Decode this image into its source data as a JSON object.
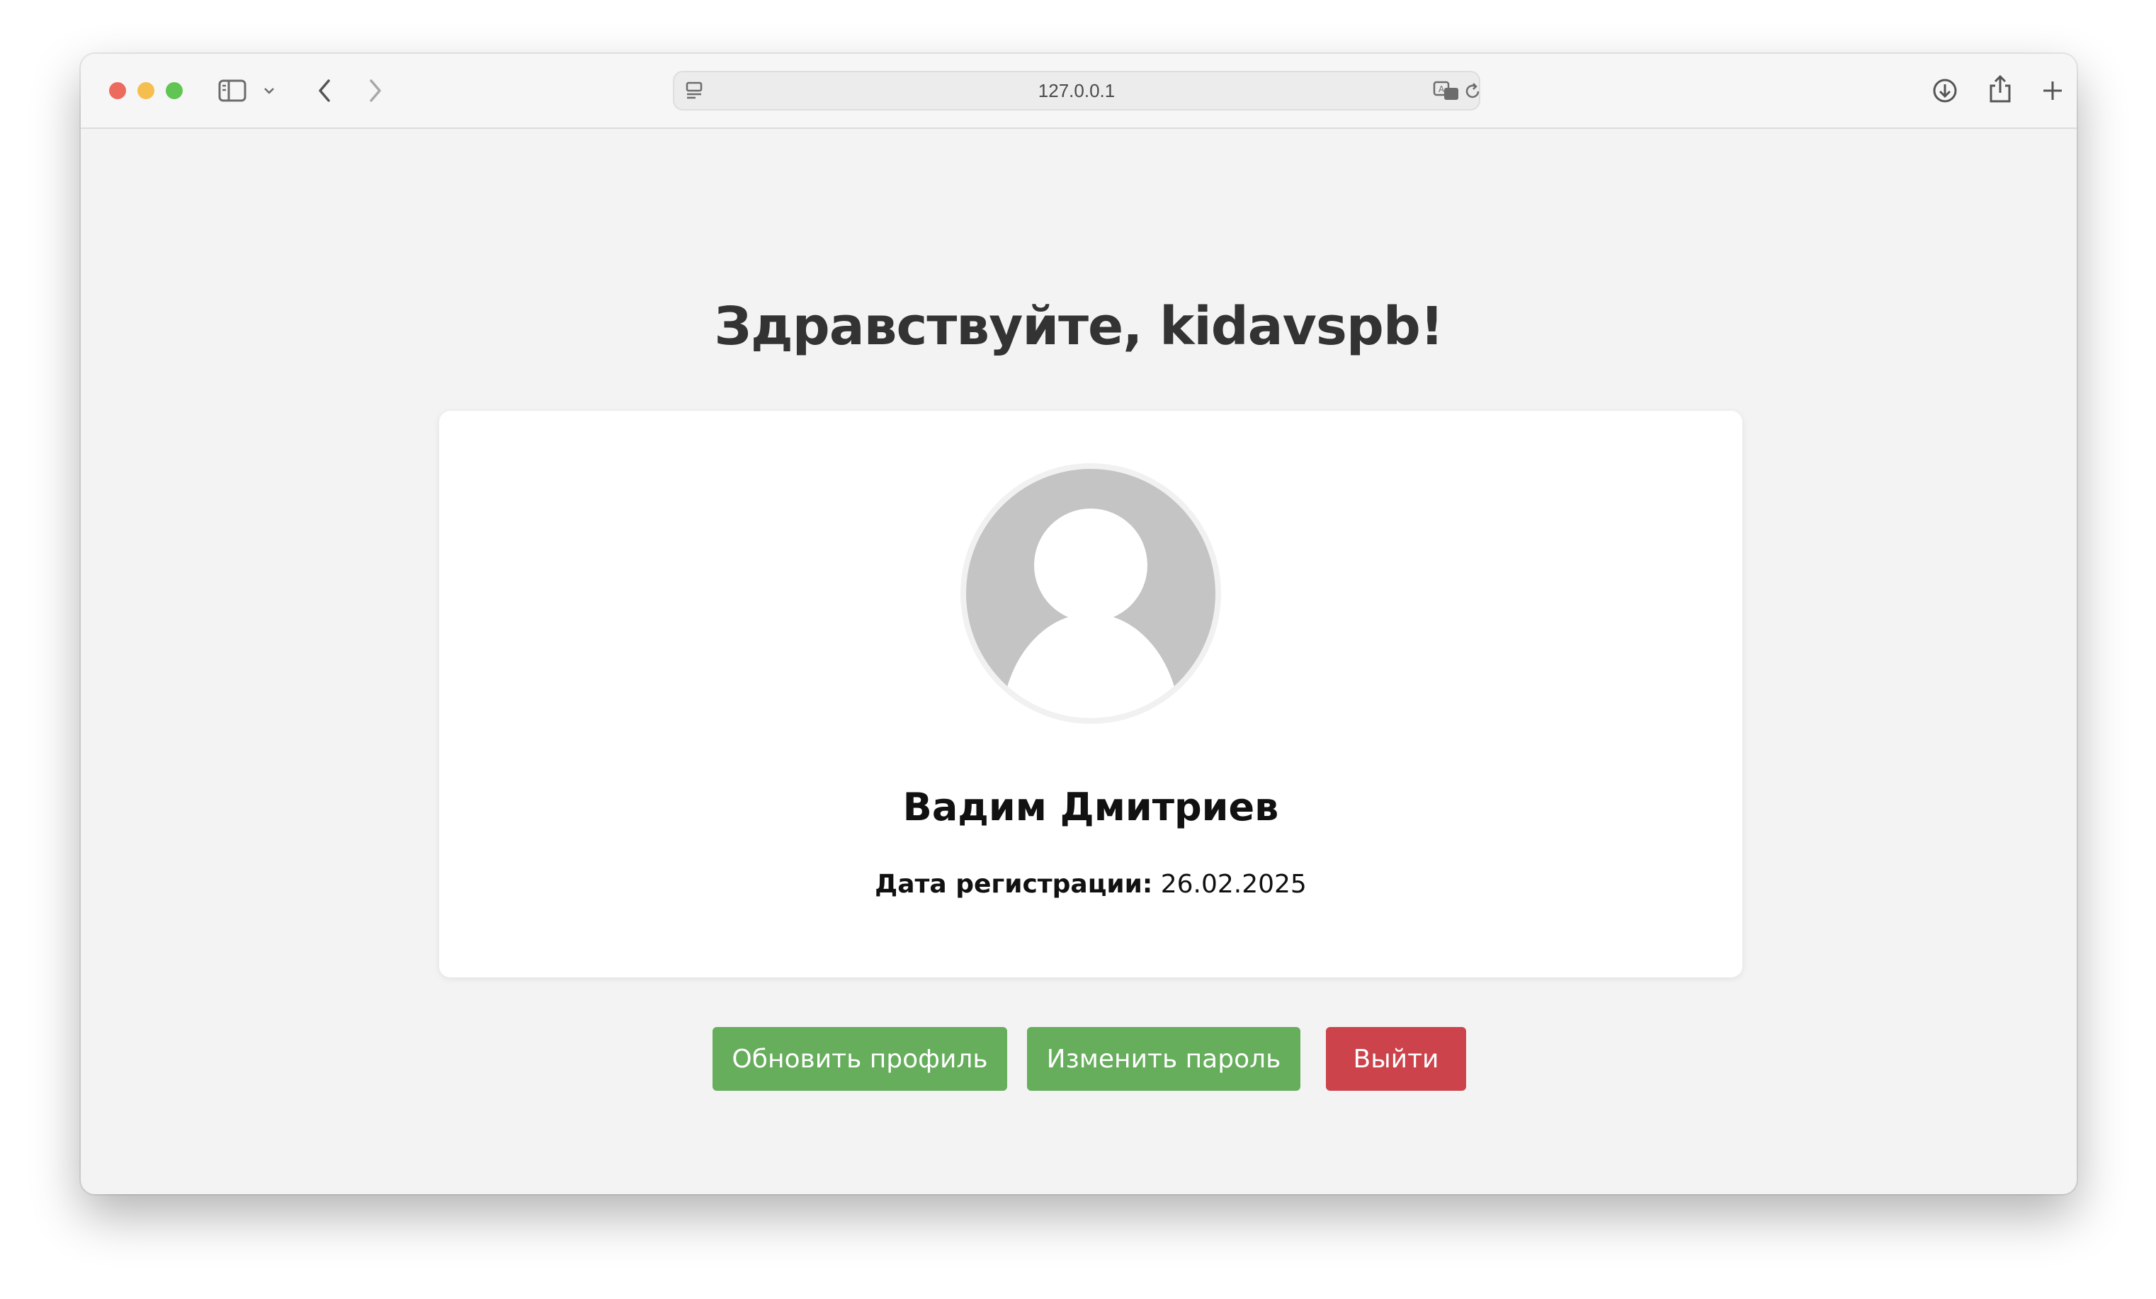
{
  "browser": {
    "url": "127.0.0.1",
    "traffic_lights": {
      "close": "#ed6a5e",
      "minimize": "#f5bf4f",
      "zoom": "#61c554"
    }
  },
  "page": {
    "greeting": "Здравствуйте, kidavspb!",
    "profile": {
      "full_name": "Вадим Дмитриев",
      "registration_label": "Дата регистрации:",
      "registration_date": "26.02.2025"
    },
    "buttons": {
      "update_profile": "Обновить профиль",
      "change_password": "Изменить пароль",
      "logout": "Выйти"
    }
  },
  "colors": {
    "page_bg": "#f3f3f3",
    "card_bg": "#ffffff",
    "primary_button": "#66ad5c",
    "danger_button": "#cc434b",
    "heading_text": "#333333"
  }
}
